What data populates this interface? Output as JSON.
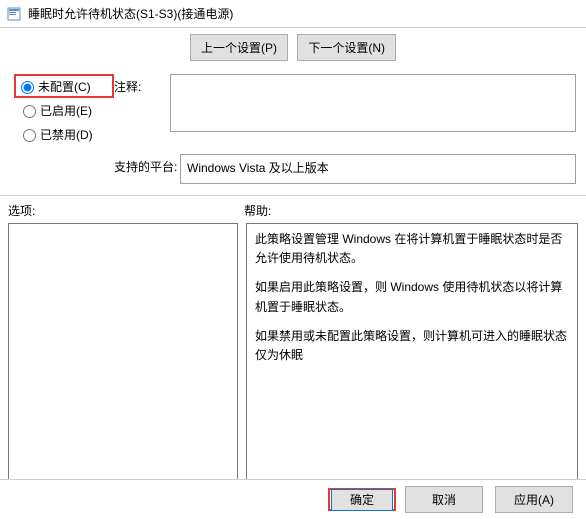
{
  "title": "睡眠时允许待机状态(S1-S3)(接通电源)",
  "nav": {
    "prev": "上一个设置(P)",
    "next": "下一个设置(N)"
  },
  "radios": {
    "not_configured": "未配置(C)",
    "enabled": "已启用(E)",
    "disabled": "已禁用(D)",
    "selected": "not_configured"
  },
  "labels": {
    "comment": "注释:",
    "platform": "支持的平台:",
    "options": "选项:",
    "help": "帮助:"
  },
  "comment_value": "",
  "platform_value": "Windows Vista 及以上版本",
  "options_text": "",
  "help_paragraphs": [
    "此策略设置管理 Windows 在将计算机置于睡眠状态时是否允许使用待机状态。",
    "如果启用此策略设置，则 Windows 使用待机状态以将计算机置于睡眠状态。",
    "如果禁用或未配置此策略设置，则计算机可进入的睡眠状态仅为休眠"
  ],
  "buttons": {
    "ok": "确定",
    "cancel": "取消",
    "apply": "应用(A)"
  }
}
